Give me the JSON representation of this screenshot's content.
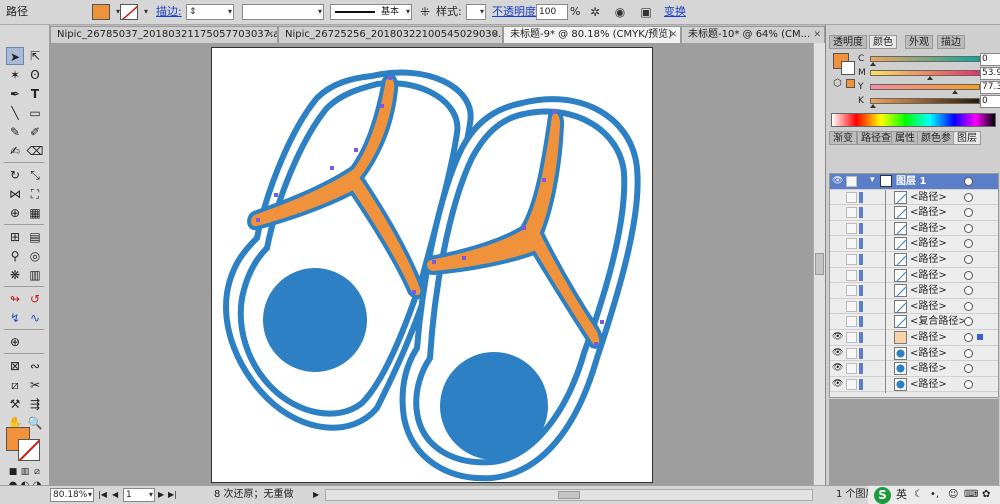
{
  "control_bar": {
    "selection_label": "路径",
    "stroke_label": "描边:",
    "stroke_profile": "基本",
    "style_label": "样式:",
    "opacity_label": "不透明度:",
    "opacity_value": "100",
    "opacity_unit": "%",
    "transform_label": "变换",
    "fill_color": "#F0923B"
  },
  "document_tabs": [
    {
      "label": "Nipic_26785037_20180321175057703037.ai*",
      "active": false
    },
    {
      "label": "Nipic_26725256_20180322100545029030.ai*",
      "active": false
    },
    {
      "label": "未标题-9* @ 80.18% (CMYK/预览)",
      "active": true
    },
    {
      "label": "未标题-10* @ 64% (CM...",
      "active": false
    }
  ],
  "color_panel": {
    "tabs": [
      "透明度",
      "颜色",
      "外观",
      "描边"
    ],
    "active_tab": "颜色",
    "channels": [
      {
        "label": "C",
        "value": "0",
        "level": 0
      },
      {
        "label": "M",
        "value": "53.91",
        "level": 53.91
      },
      {
        "label": "Y",
        "value": "77.34",
        "level": 77.34
      },
      {
        "label": "K",
        "value": "0",
        "level": 0
      }
    ],
    "unit": "%"
  },
  "layers_panel": {
    "tabs": [
      "渐变",
      "路径查",
      "属性",
      "颜色参",
      "图层"
    ],
    "active_tab": "图层",
    "layer_name": "图层 1",
    "items": [
      {
        "name": "<路径>",
        "visible": false,
        "selected": false
      },
      {
        "name": "<路径>",
        "visible": false,
        "selected": false
      },
      {
        "name": "<路径>",
        "visible": false,
        "selected": false
      },
      {
        "name": "<路径>",
        "visible": false,
        "selected": false
      },
      {
        "name": "<路径>",
        "visible": false,
        "selected": false
      },
      {
        "name": "<路径>",
        "visible": false,
        "selected": false
      },
      {
        "name": "<路径>",
        "visible": false,
        "selected": false
      },
      {
        "name": "<路径>",
        "visible": false,
        "selected": false
      },
      {
        "name": "<复合路径>",
        "visible": false,
        "selected": false
      },
      {
        "name": "<路径>",
        "visible": true,
        "selected": true
      },
      {
        "name": "<路径>",
        "visible": true,
        "selected": false
      },
      {
        "name": "<路径>",
        "visible": true,
        "selected": false
      },
      {
        "name": "<路径>",
        "visible": true,
        "selected": false
      }
    ],
    "footer": "1 个图层"
  },
  "status_bar": {
    "zoom": "80.18%",
    "page": "1",
    "undo_text": "8 次还原；无重做"
  },
  "ime": {
    "lang": "英"
  },
  "colors": {
    "orange": "#F0923B",
    "blue": "#2C80C3",
    "selection": "#7B5CE0"
  }
}
